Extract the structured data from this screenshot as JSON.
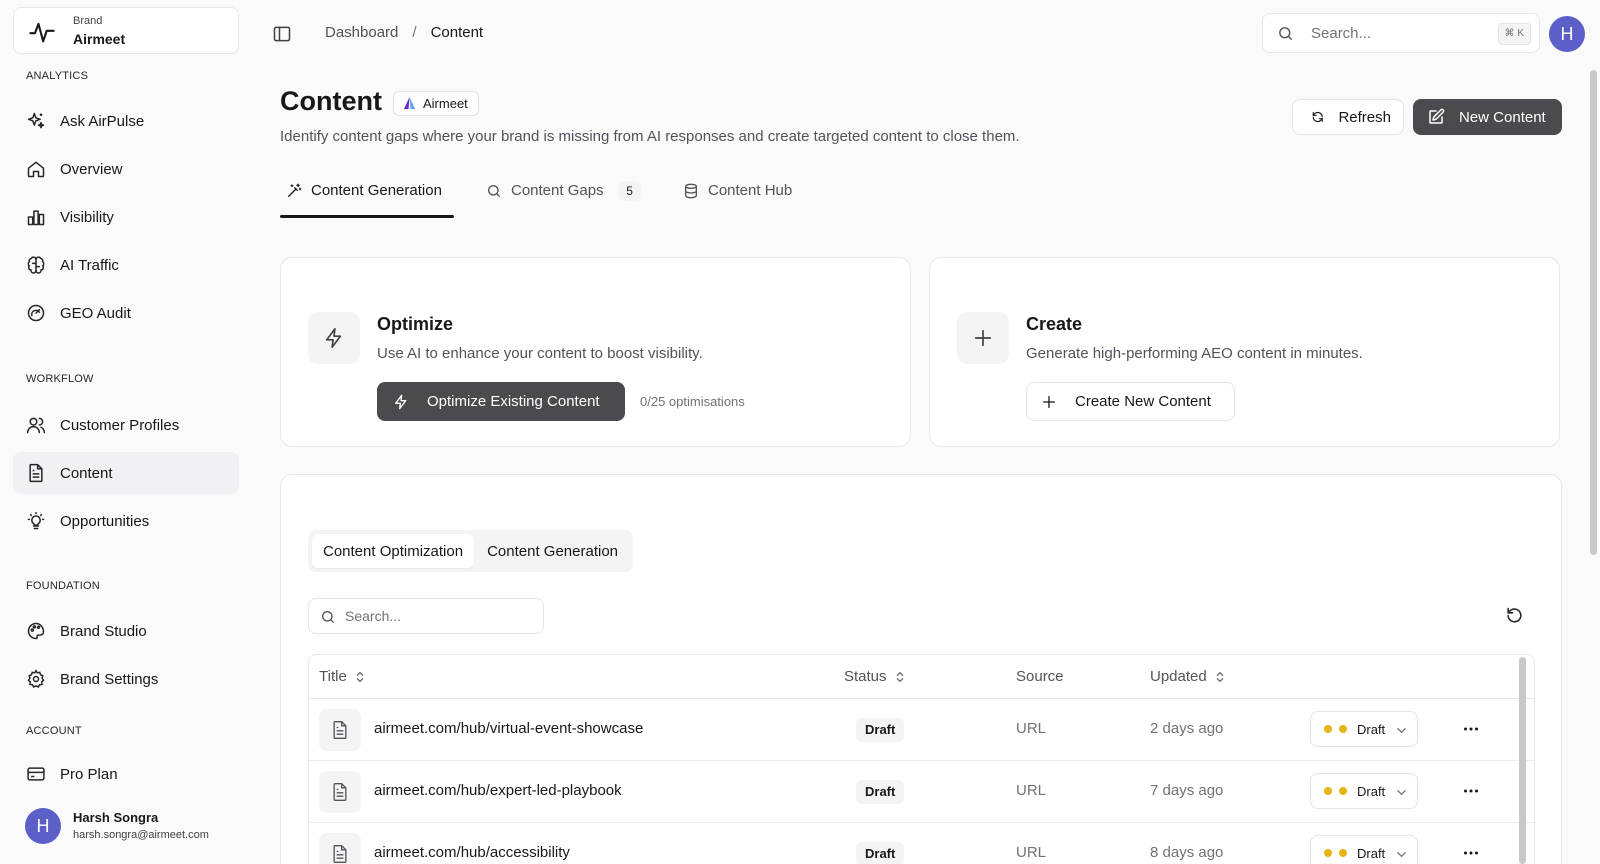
{
  "sidebar": {
    "brand": {
      "caption": "Brand",
      "name": "Airmeet"
    },
    "sections": {
      "analytics": "ANALYTICS",
      "workflow": "WORKFLOW",
      "foundation": "FOUNDATION",
      "account": "ACCOUNT"
    },
    "items": [
      {
        "label": "Ask AirPulse",
        "icon": "sparkles-icon"
      },
      {
        "label": "Overview",
        "icon": "home-icon"
      },
      {
        "label": "Visibility",
        "icon": "bar-chart-icon"
      },
      {
        "label": "AI Traffic",
        "icon": "brain-icon"
      },
      {
        "label": "GEO Audit",
        "icon": "gauge-icon"
      },
      {
        "label": "Customer Profiles",
        "icon": "users-icon"
      },
      {
        "label": "Content",
        "icon": "file-text-icon",
        "active": true
      },
      {
        "label": "Opportunities",
        "icon": "lightbulb-icon"
      },
      {
        "label": "Brand Studio",
        "icon": "palette-icon"
      },
      {
        "label": "Brand Settings",
        "icon": "gear-icon"
      },
      {
        "label": "Pro Plan",
        "icon": "credit-card-icon"
      }
    ],
    "user": {
      "initial": "H",
      "name": "Harsh Songra",
      "email": "harsh.songra@airmeet.com"
    }
  },
  "topbar": {
    "breadcrumb": [
      "Dashboard",
      "Content"
    ],
    "breadcrumb_separator": "/",
    "search_placeholder": "Search...",
    "shortcut": "⌘ K",
    "avatar_initial": "H"
  },
  "header": {
    "title": "Content",
    "brand_pill": "Airmeet",
    "subtitle": "Identify content gaps where your brand is missing from AI responses and create targeted content to close them.",
    "refresh_label": "Refresh",
    "new_content_label": "New Content"
  },
  "tabs": [
    {
      "label": "Content Generation",
      "icon": "wand-icon",
      "active": true
    },
    {
      "label": "Content Gaps",
      "icon": "search-icon",
      "badge": "5"
    },
    {
      "label": "Content Hub",
      "icon": "database-icon"
    }
  ],
  "optimize_card": {
    "title": "Optimize",
    "description": "Use AI to enhance your content to boost visibility.",
    "button_label": "Optimize Existing Content",
    "usage": "0/25 optimisations"
  },
  "create_card": {
    "title": "Create",
    "description": "Generate high-performing AEO content in minutes.",
    "button_label": "Create New Content"
  },
  "table_section": {
    "segments": [
      "Content Optimization",
      "Content Generation"
    ],
    "search_placeholder": "Search...",
    "columns": {
      "title": "Title",
      "status": "Status",
      "source": "Source",
      "updated": "Updated"
    },
    "rows": [
      {
        "title": "airmeet.com/hub/virtual-event-showcase",
        "status": "Draft",
        "source": "URL",
        "updated": "2 days ago",
        "select": "Draft"
      },
      {
        "title": "airmeet.com/hub/expert-led-playbook",
        "status": "Draft",
        "source": "URL",
        "updated": "7 days ago",
        "select": "Draft"
      },
      {
        "title": "airmeet.com/hub/accessibility",
        "status": "Draft",
        "source": "URL",
        "updated": "8 days ago",
        "select": "Draft"
      }
    ]
  },
  "colors": {
    "accent_dark": "#4a4a4f",
    "avatar": "#5b5fc7",
    "draft_dot": "#e6b414"
  }
}
